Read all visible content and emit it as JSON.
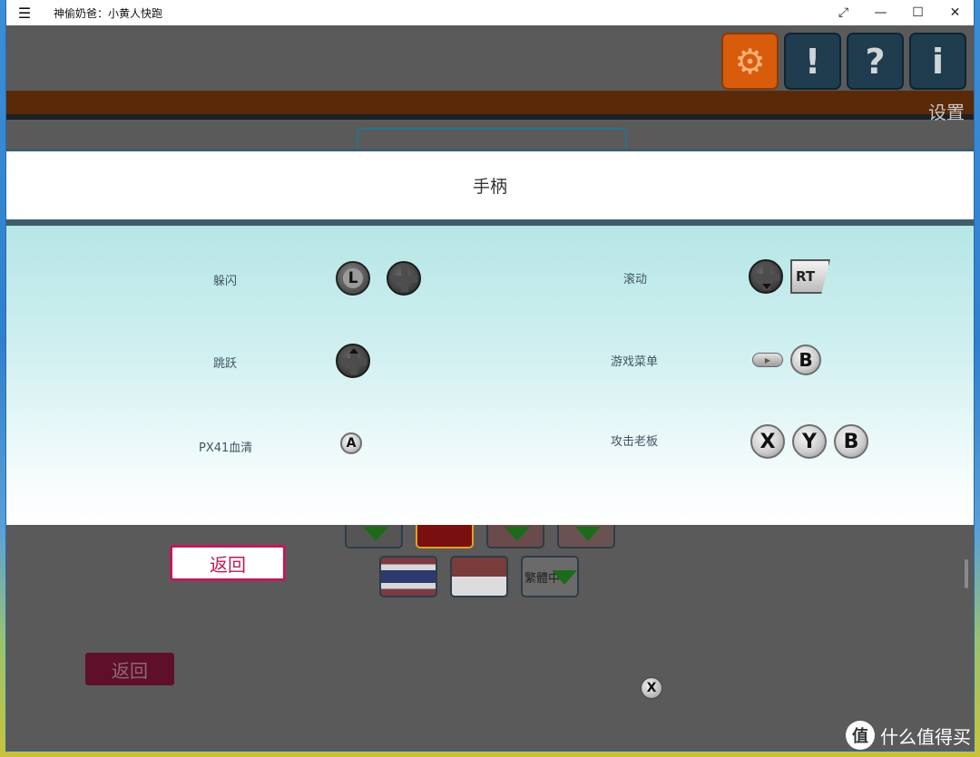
{
  "window": {
    "title": "神偷奶爸：小黄人快跑",
    "menu_icon": "hamburger-icon",
    "controls": [
      "resize-icon",
      "minimize-icon",
      "maximize-icon",
      "close-icon"
    ],
    "glyphs": {
      "menu": "☰",
      "resize": "⤢",
      "minimize": "—",
      "maximize": "☐",
      "close": "✕"
    }
  },
  "top_icons": [
    {
      "name": "settings-gear",
      "glyph": "⚙",
      "active": true
    },
    {
      "name": "exclamation-refresh",
      "glyph": "!",
      "active": false
    },
    {
      "name": "help-book",
      "glyph": "?",
      "active": false
    },
    {
      "name": "info",
      "glyph": "i",
      "active": false
    }
  ],
  "settings_label": "设置",
  "dialog": {
    "title": "手柄",
    "mappings": [
      {
        "label": "躲闪",
        "buttons": [
          "stick-L",
          "dpad"
        ]
      },
      {
        "label": "跳跃",
        "buttons": [
          "dpad-up"
        ]
      },
      {
        "label": "PX41血清",
        "buttons": [
          "A"
        ]
      },
      {
        "label": "滚动",
        "buttons": [
          "dpad-down",
          "RT"
        ]
      },
      {
        "label": "游戏菜单",
        "buttons": [
          "start",
          "B"
        ]
      },
      {
        "label": "攻击老板",
        "buttons": [
          "X",
          "Y",
          "B"
        ]
      }
    ],
    "glyphs": {
      "L": "L",
      "RT": "RT",
      "A": "A",
      "B": "B",
      "X": "X",
      "Y": "Y",
      "start": "▶"
    }
  },
  "lower": {
    "back_label": "返回",
    "back_label_dark": "返回",
    "lang_traditional": "繁體中",
    "close_glyph": "X"
  },
  "watermark": {
    "icon": "值",
    "text": "什么值得买"
  },
  "colors": {
    "accent_orange": "#d85c0c",
    "back_pink": "#c2185b",
    "dialog_header": "#ffffff"
  }
}
